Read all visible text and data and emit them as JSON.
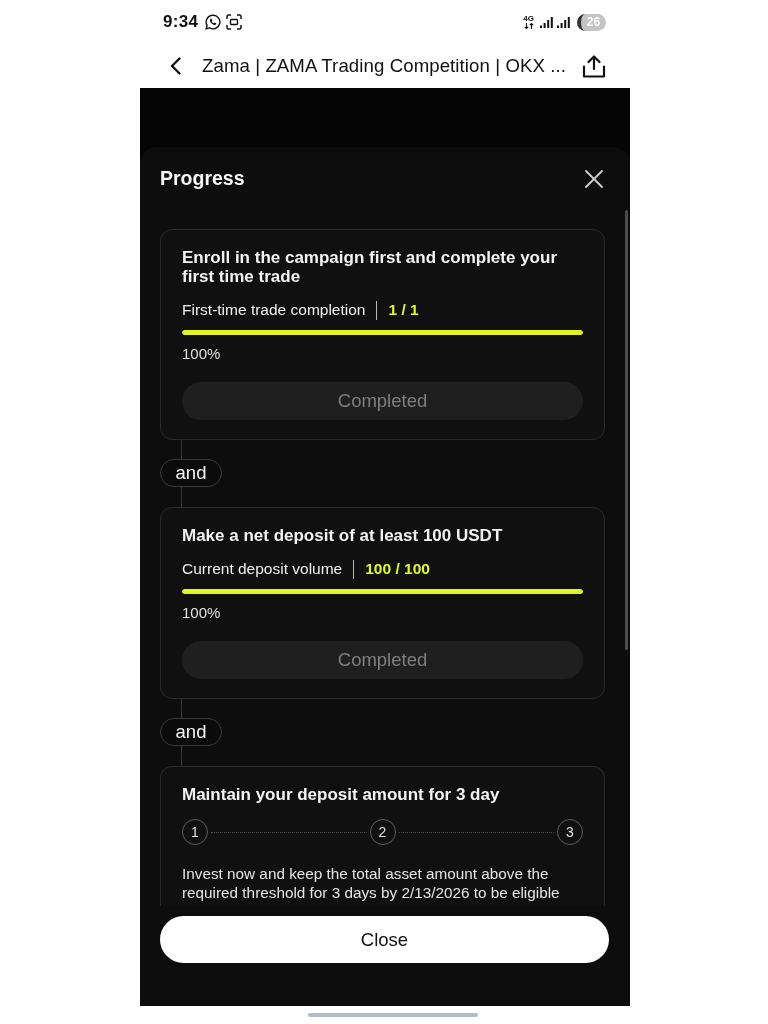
{
  "status_bar": {
    "time": "9:34",
    "network": "4G",
    "battery": "26"
  },
  "nav_bar": {
    "title": "Zama | ZAMA Trading Competition | OKX ..."
  },
  "sheet": {
    "title": "Progress",
    "items": [
      {
        "kind": "task",
        "title": "Enroll in the campaign first and complete your first time trade",
        "metric_label": "First-time trade completion",
        "metric_value": "1 / 1",
        "level": 1,
        "percent": "100%",
        "button": {
          "label": "Completed",
          "disabled": true
        }
      },
      {
        "kind": "joiner",
        "label": "and"
      },
      {
        "kind": "task",
        "title": "Make a net deposit of at least 100 USDT",
        "metric_label": "Current deposit volume",
        "metric_value": "100 / 100",
        "level": 1,
        "percent": "100%",
        "button": {
          "label": "Completed",
          "disabled": true
        }
      },
      {
        "kind": "joiner",
        "label": "and"
      },
      {
        "kind": "days",
        "title": "Maintain your deposit amount for 3 day",
        "days": [
          "1",
          "2",
          "3"
        ],
        "description": "Invest now and keep the total asset amount above the required threshold for 3 days by 2/13/2026 to be eligible"
      }
    ],
    "close_button": "Close"
  }
}
